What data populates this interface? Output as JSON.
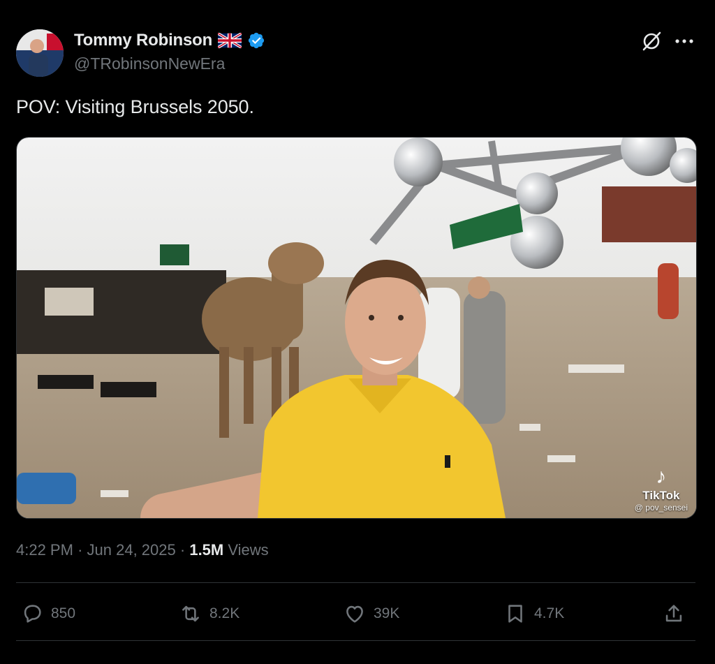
{
  "author": {
    "display_name": "Tommy Robinson",
    "handle": "@TRobinsonNewEra",
    "flag_icon": "uk-flag-icon",
    "verified_icon": "verified-badge-icon"
  },
  "tweet": {
    "text": "POV: Visiting Brussels 2050."
  },
  "media": {
    "watermark_brand": "TikTok",
    "watermark_user": "@ pov_sensei"
  },
  "meta": {
    "time": "4:22 PM",
    "separator": "·",
    "date": "Jun 24, 2025",
    "views_count": "1.5M",
    "views_label": "Views"
  },
  "actions": {
    "replies": "850",
    "reposts": "8.2K",
    "likes": "39K",
    "bookmarks": "4.7K"
  },
  "colors": {
    "background": "#000000",
    "text": "#e7e9ea",
    "secondary": "#71767b",
    "verified": "#1d9bf0",
    "divider": "#2f3336"
  }
}
